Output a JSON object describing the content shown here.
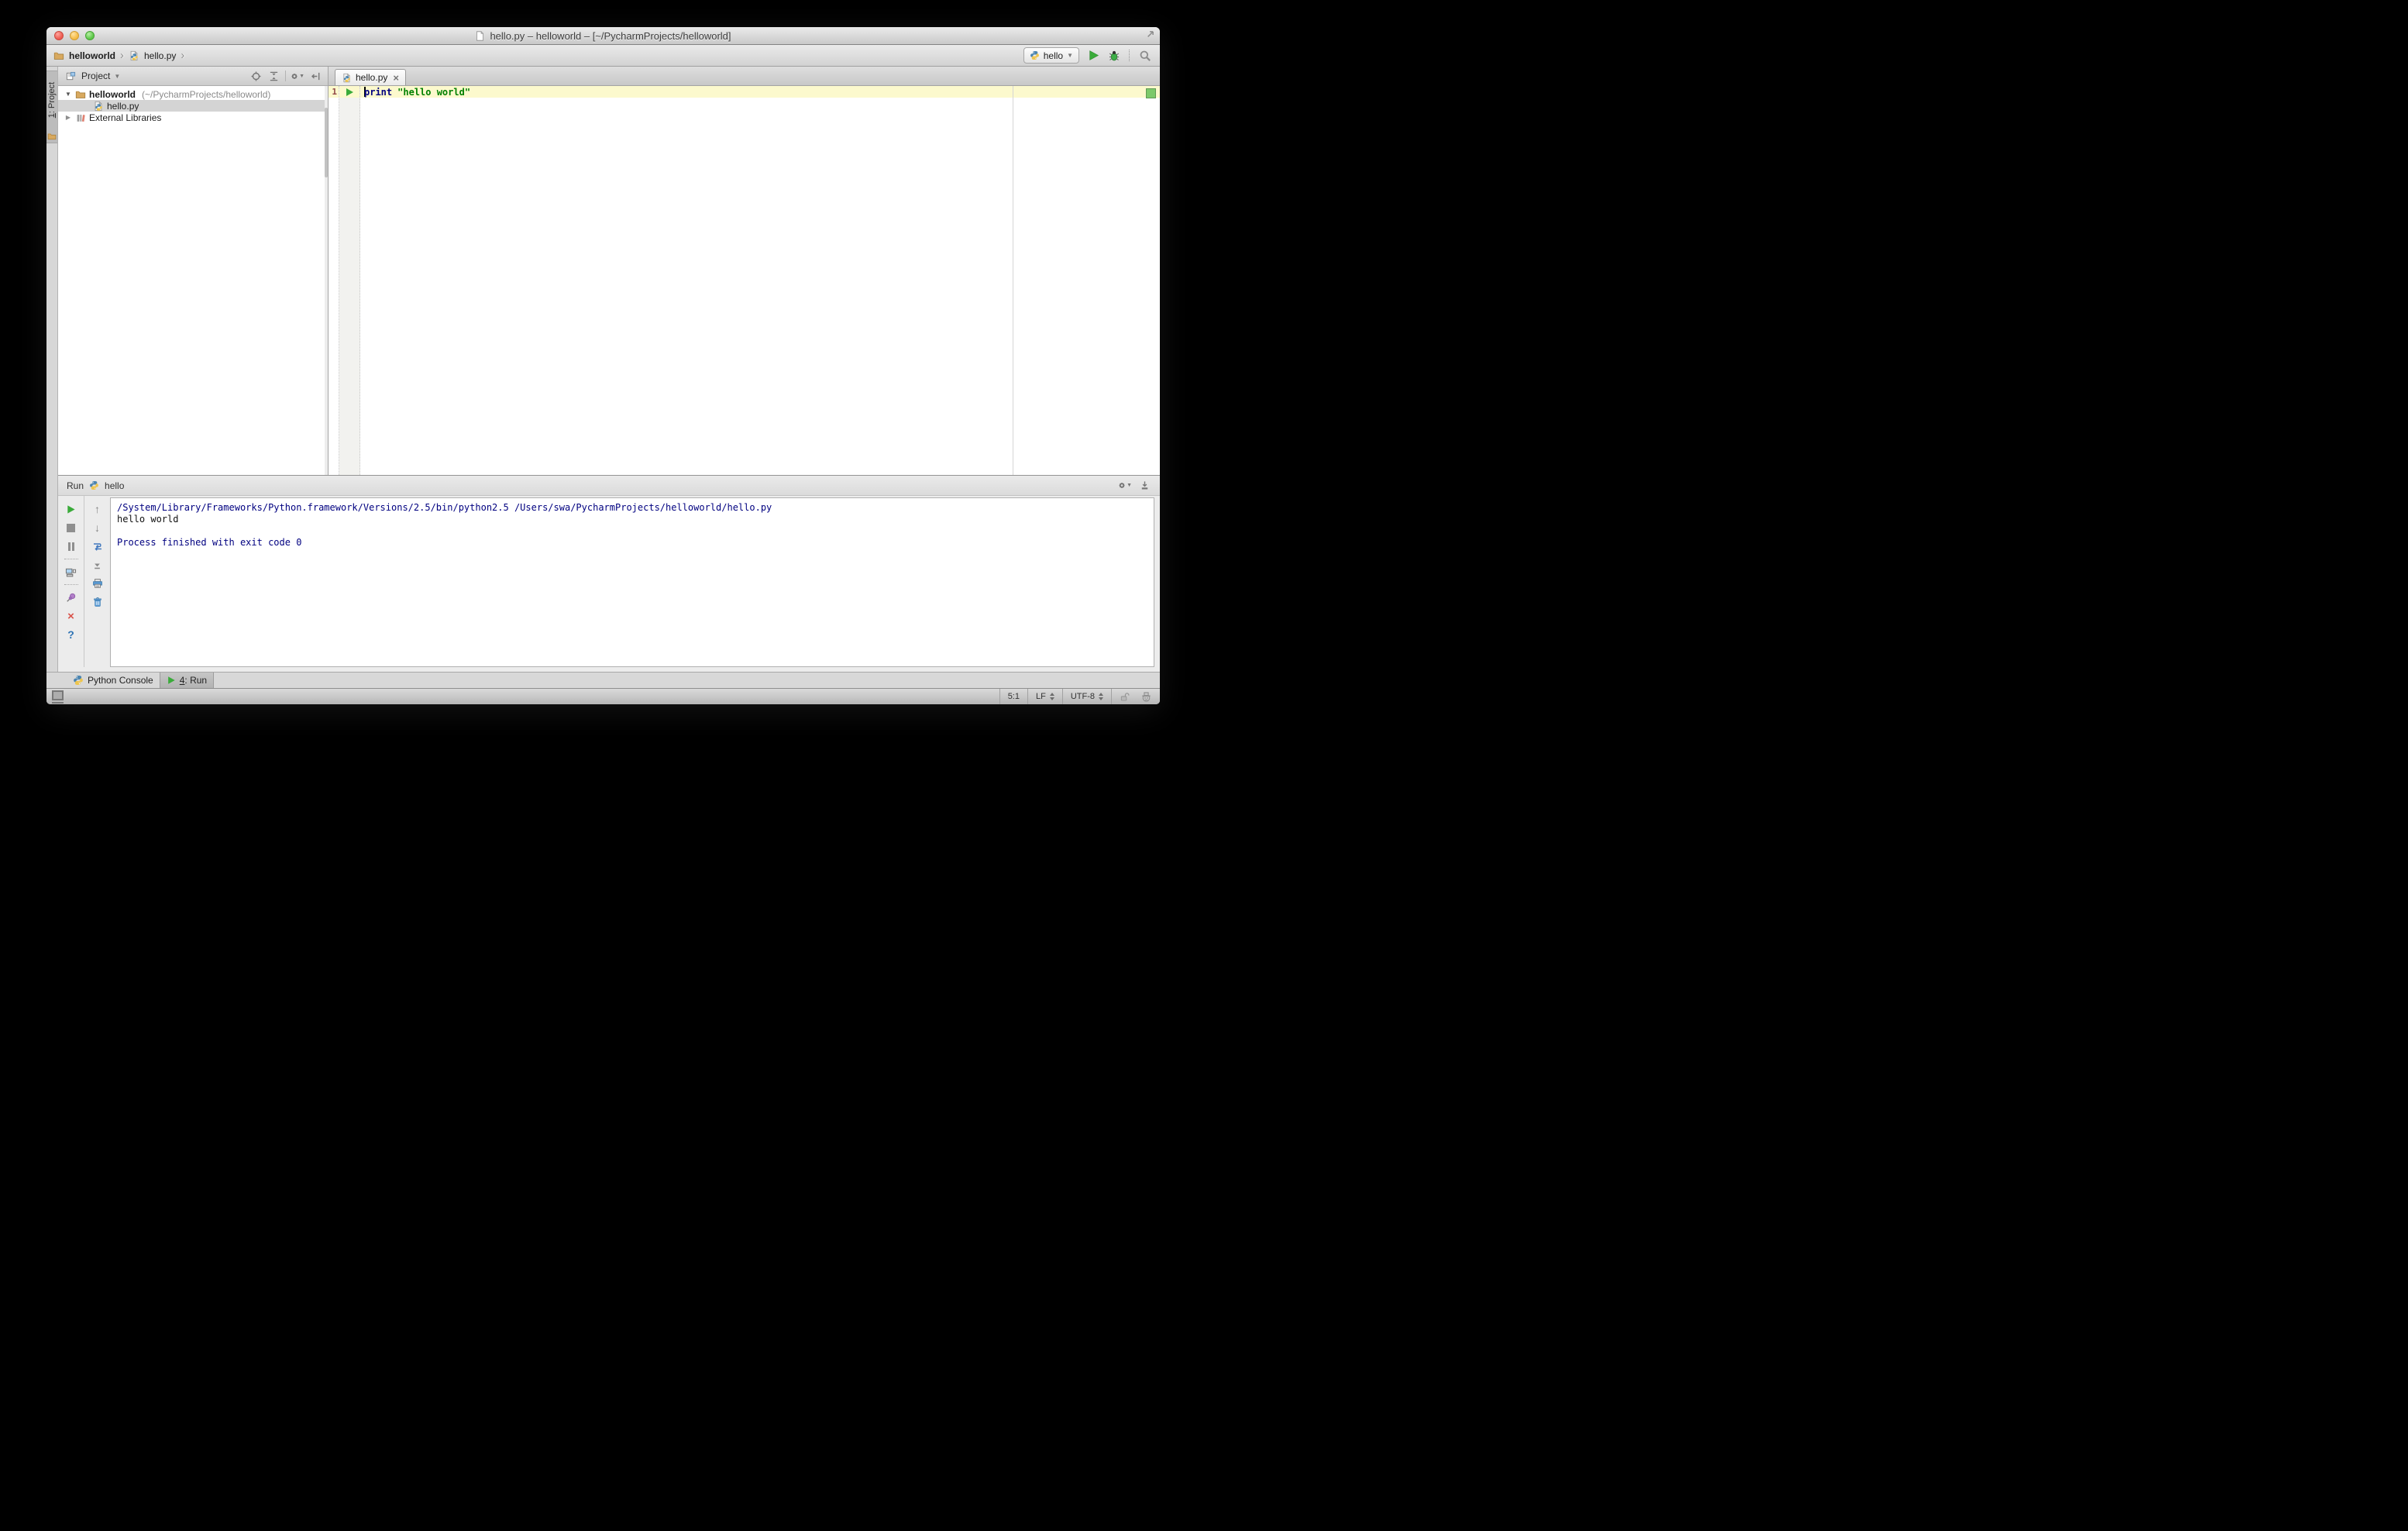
{
  "title_bar": {
    "title": "hello.py – helloworld – [~/PycharmProjects/helloworld]"
  },
  "navbar": {
    "breadcrumb_project": "helloworld",
    "breadcrumb_file": "hello.py",
    "run_config": "hello"
  },
  "stripe": {
    "tab_num": "1",
    "tab_rest": ": Project"
  },
  "project_panel": {
    "header": "Project",
    "root_name": "helloworld",
    "root_path": "(~/PycharmProjects/helloworld)",
    "file": "hello.py",
    "external_libraries": "External Libraries"
  },
  "editor": {
    "tab": "hello.py",
    "line_number": "1",
    "keyword": "print",
    "string_literal": "\"hello world\""
  },
  "run_panel": {
    "label": "Run",
    "config": "hello",
    "console": [
      {
        "text": "/System/Library/Frameworks/Python.framework/Versions/2.5/bin/python2.5 /Users/swa/PycharmProjects/helloworld/hello.py"
      },
      {
        "text": "hello world"
      },
      {
        "text": ""
      },
      {
        "text": "Process finished with exit code 0"
      }
    ]
  },
  "bottom_bar": {
    "python_console": "Python Console",
    "run_tab_num": "4",
    "run_tab_rest": ": Run"
  },
  "status_bar": {
    "caret_position": "5:1",
    "line_ending": "LF",
    "encoding": "UTF-8"
  },
  "colors": {
    "keyword": "#000080",
    "string": "#008000",
    "console_info": "#000080",
    "caret_row": "#fcf9cd",
    "run_green": "#3aab3a",
    "selection_inactive": "#d4d4d4",
    "inspection_ok": "#7cc96a"
  }
}
